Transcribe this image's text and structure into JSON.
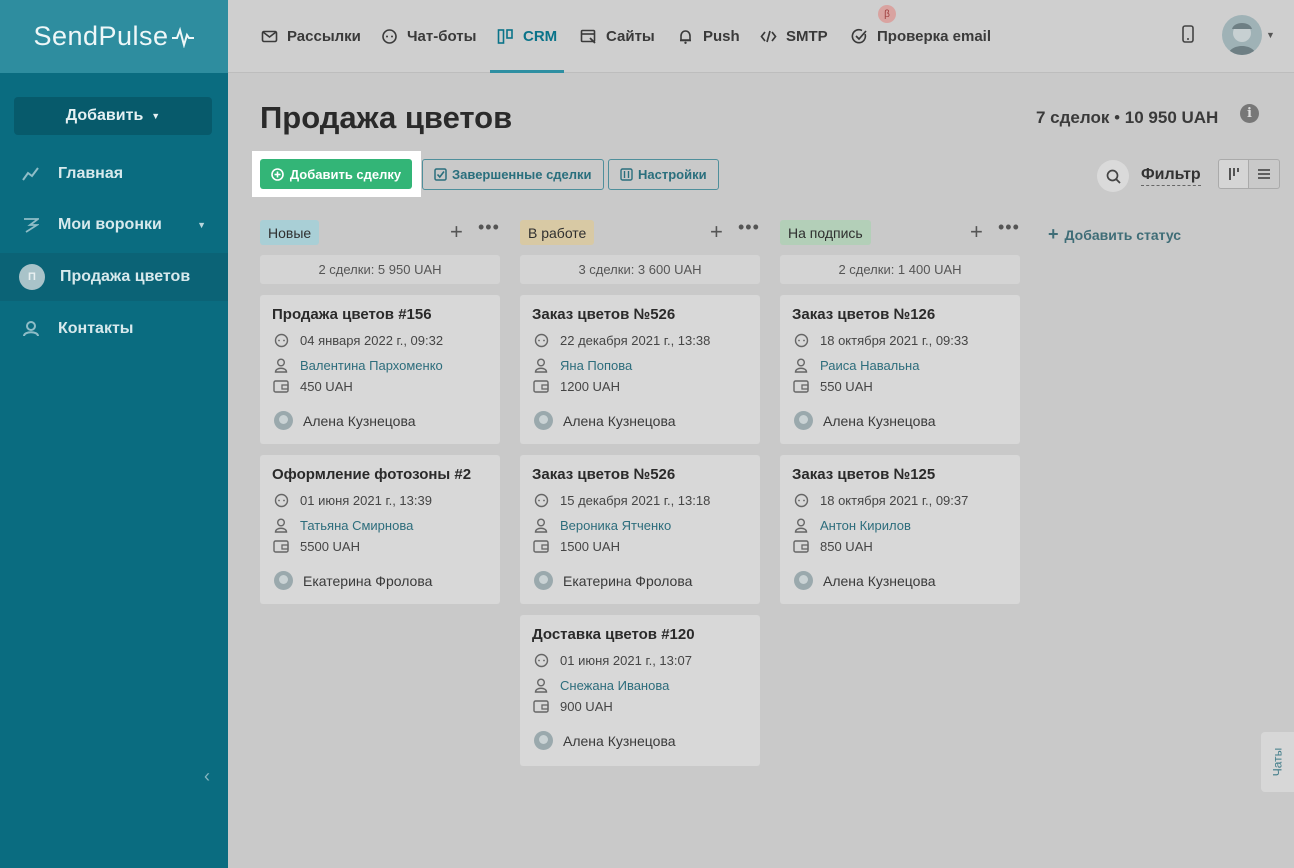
{
  "brand": {
    "logo_text": "SendPulse"
  },
  "sidebar": {
    "add_label": "Добавить",
    "items": [
      {
        "label": "Главная"
      },
      {
        "label": "Мои воронки"
      },
      {
        "label": "Продажа цветов",
        "initial": "П"
      },
      {
        "label": "Контакты"
      }
    ]
  },
  "topnav": {
    "tabs": [
      {
        "label": "Рассылки"
      },
      {
        "label": "Чат-боты"
      },
      {
        "label": "CRM"
      },
      {
        "label": "Сайты"
      },
      {
        "label": "Push"
      },
      {
        "label": "SMTP"
      },
      {
        "label": "Проверка email"
      }
    ],
    "beta_badge": "β"
  },
  "page": {
    "title": "Продажа цветов",
    "deals_count": "7 сделок",
    "separator": "•",
    "deals_total": "10 950 UAH",
    "info": "i"
  },
  "toolbar": {
    "add_deal": "Добавить сделку",
    "completed": "Завершенные сделки",
    "settings": "Настройки",
    "filter": "Фильтр"
  },
  "add_status": "Добавить статус",
  "columns": [
    {
      "status": "Новые",
      "color": "#a9cfd6",
      "summary": "2 сделки: 5 950 UAH",
      "cards": [
        {
          "title": "Продажа цветов #156",
          "date": "04 января 2022 г., 09:32",
          "contact": "Валентина Пархоменко",
          "amount": "450 UAH",
          "owner": "Алена Кузнецова"
        },
        {
          "title": "Оформление фотозоны #2",
          "date": "01 июня 2021 г., 13:39",
          "contact": "Татьяна Смирнова",
          "amount": "5500 UAH",
          "owner": "Екатерина Фролова"
        }
      ]
    },
    {
      "status": "В работе",
      "color": "#d8c9a4",
      "summary": "3 сделки: 3 600 UAH",
      "cards": [
        {
          "title": "Заказ цветов №526",
          "date": "22 декабря 2021 г., 13:38",
          "contact": "Яна Попова",
          "amount": "1200 UAH",
          "owner": "Алена Кузнецова"
        },
        {
          "title": "Заказ цветов №526",
          "date": "15 декабря 2021 г., 13:18",
          "contact": "Вероника Ятченко",
          "amount": "1500 UAH",
          "owner": "Екатерина Фролова"
        },
        {
          "title": "Доставка цветов #120",
          "date": "01 июня 2021 г., 13:07",
          "contact": "Снежана Иванова",
          "amount": "900 UAH",
          "owner": "Алена Кузнецова"
        }
      ]
    },
    {
      "status": "На подпись",
      "color": "#b3cfb8",
      "summary": "2 сделки: 1 400 UAH",
      "cards": [
        {
          "title": "Заказ цветов №126",
          "date": "18 октября 2021 г., 09:33",
          "contact": "Раиса Навальна",
          "amount": "550 UAH",
          "owner": "Алена Кузнецова"
        },
        {
          "title": "Заказ цветов №125",
          "date": "18 октября 2021 г., 09:37",
          "contact": "Антон Кирилов",
          "amount": "850 UAH",
          "owner": "Алена Кузнецова"
        }
      ]
    }
  ],
  "chats_tab": "Чаты"
}
